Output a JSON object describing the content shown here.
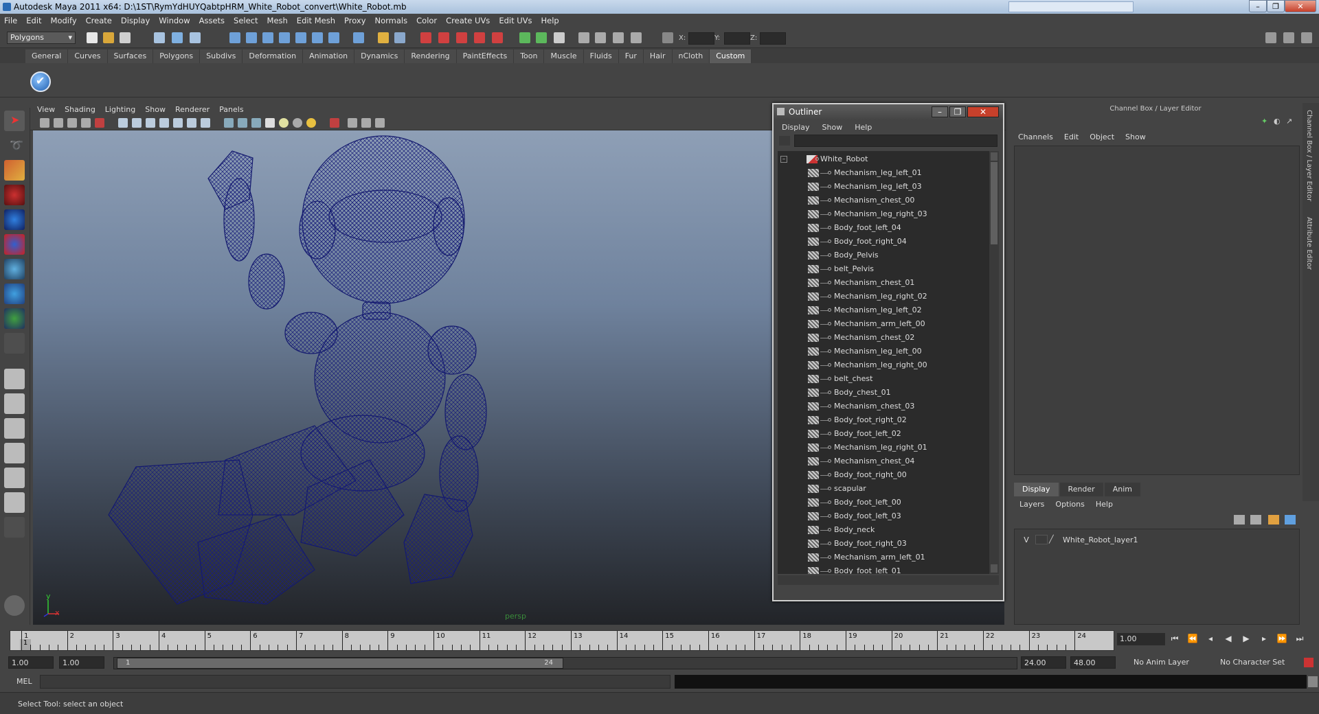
{
  "window": {
    "title": "Autodesk Maya 2011 x64: D:\\1ST\\RymYdHUYQabtpHRM_White_Robot_convert\\White_Robot.mb",
    "controls": [
      "–",
      "❐",
      "✕"
    ]
  },
  "menubar": [
    "File",
    "Edit",
    "Modify",
    "Create",
    "Display",
    "Window",
    "Assets",
    "Select",
    "Mesh",
    "Edit Mesh",
    "Proxy",
    "Normals",
    "Color",
    "Create UVs",
    "Edit UVs",
    "Help"
  ],
  "toolbar": {
    "mode": "Polygons",
    "x_label": "X:",
    "y_label": "Y:",
    "z_label": "Z:"
  },
  "shelf_tabs": [
    "General",
    "Curves",
    "Surfaces",
    "Polygons",
    "Subdivs",
    "Deformation",
    "Animation",
    "Dynamics",
    "Rendering",
    "PaintEffects",
    "Toon",
    "Muscle",
    "Fluids",
    "Fur",
    "Hair",
    "nCloth",
    "Custom"
  ],
  "shelf_active": "Custom",
  "viewport": {
    "menu": [
      "View",
      "Shading",
      "Lighting",
      "Show",
      "Renderer",
      "Panels"
    ],
    "camera": "persp",
    "axis_y": "y",
    "axis_x": "x",
    "wire_color": "#1a1f7a"
  },
  "outliner": {
    "title": "Outliner",
    "menu": [
      "Display",
      "Show",
      "Help"
    ],
    "root": "White_Robot",
    "items": [
      "Mechanism_leg_left_01",
      "Mechanism_leg_left_03",
      "Mechanism_chest_00",
      "Mechanism_leg_right_03",
      "Body_foot_left_04",
      "Body_foot_right_04",
      "Body_Pelvis",
      "belt_Pelvis",
      "Mechanism_chest_01",
      "Mechanism_leg_right_02",
      "Mechanism_leg_left_02",
      "Mechanism_arm_left_00",
      "Mechanism_chest_02",
      "Mechanism_leg_left_00",
      "Mechanism_leg_right_00",
      "belt_chest",
      "Body_chest_01",
      "Mechanism_chest_03",
      "Body_foot_right_02",
      "Body_foot_left_02",
      "Mechanism_leg_right_01",
      "Mechanism_chest_04",
      "Body_foot_right_00",
      "scapular",
      "Body_foot_left_00",
      "Body_foot_left_03",
      "Body_neck",
      "Body_foot_right_03",
      "Mechanism_arm_left_01",
      "Body_foot_left_01"
    ]
  },
  "channel_box": {
    "title": "Channel Box / Layer Editor",
    "menu": [
      "Channels",
      "Edit",
      "Object",
      "Show"
    ],
    "side_tabs": [
      "Channel Box / Layer Editor",
      "Attribute Editor"
    ]
  },
  "layer_editor": {
    "tabs": [
      "Display",
      "Render",
      "Anim"
    ],
    "active_tab": "Display",
    "menu": [
      "Layers",
      "Options",
      "Help"
    ],
    "layer": {
      "visible": "V",
      "name": "White_Robot_layer1"
    }
  },
  "timeline": {
    "ticks": [
      "1",
      "2",
      "3",
      "4",
      "5",
      "6",
      "7",
      "8",
      "9",
      "10",
      "11",
      "12",
      "13",
      "14",
      "15",
      "16",
      "17",
      "18",
      "19",
      "20",
      "21",
      "22",
      "23",
      "24"
    ],
    "current_frame_marker": "1",
    "current_time": "1.00"
  },
  "range": {
    "start": "1.00",
    "playback_start": "1.00",
    "thumb_start": "1",
    "thumb_end": "24",
    "playback_end": "24.00",
    "end": "48.00",
    "anim_layer": "No Anim Layer",
    "character_set": "No Character Set"
  },
  "command_line": {
    "label": "MEL"
  },
  "help_line": "Select Tool: select an object"
}
